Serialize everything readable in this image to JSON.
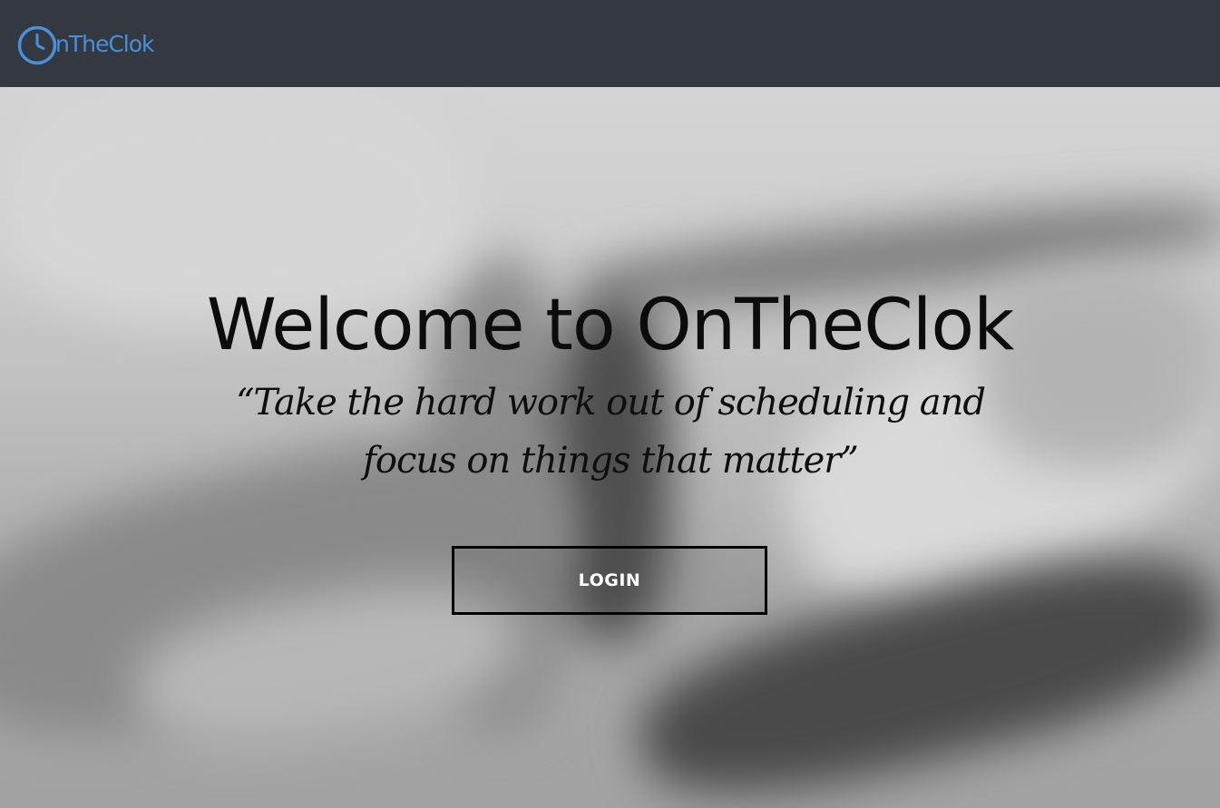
{
  "brand": {
    "name": "nTheClok",
    "accent_color": "#4a90d9",
    "logo_icon": "clock-icon"
  },
  "navbar": {
    "background_color": "#343841"
  },
  "hero": {
    "title": "Welcome to OnTheClok",
    "quote": "“Take the hard work out of scheduling and focus on things that matter”",
    "background_image": "blurred-desk-photo"
  },
  "actions": {
    "login_label": "LOGIN"
  }
}
